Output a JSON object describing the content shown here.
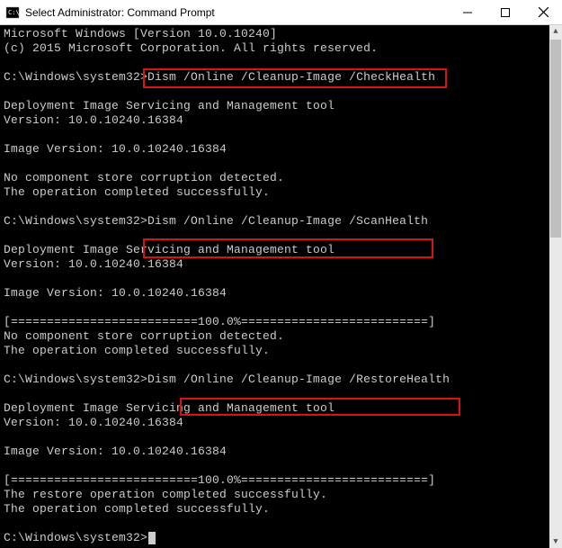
{
  "titlebar": {
    "title": "Select Administrator: Command Prompt"
  },
  "terminal": {
    "line1": "Microsoft Windows [Version 10.0.10240]",
    "line2": "(c) 2015 Microsoft Corporation. All rights reserved.",
    "blank": " ",
    "prompt": "C:\\Windows\\system32>",
    "cmd1": "Dism /Online /Cleanup-Image /CheckHealth",
    "cmd2": "Dism /Online /Cleanup-Image /ScanHealth",
    "cmd3": "Dism /Online /Cleanup-Image /RestoreHealth",
    "dism_title": "Deployment Image Servicing and Management tool",
    "dism_version": "Version: 10.0.10240.16384",
    "image_version": "Image Version: 10.0.10240.16384",
    "no_corruption": "No component store corruption detected.",
    "op_success": "The operation completed successfully.",
    "progress": "[==========================100.0%==========================]",
    "restore_success": "The restore operation completed successfully."
  }
}
